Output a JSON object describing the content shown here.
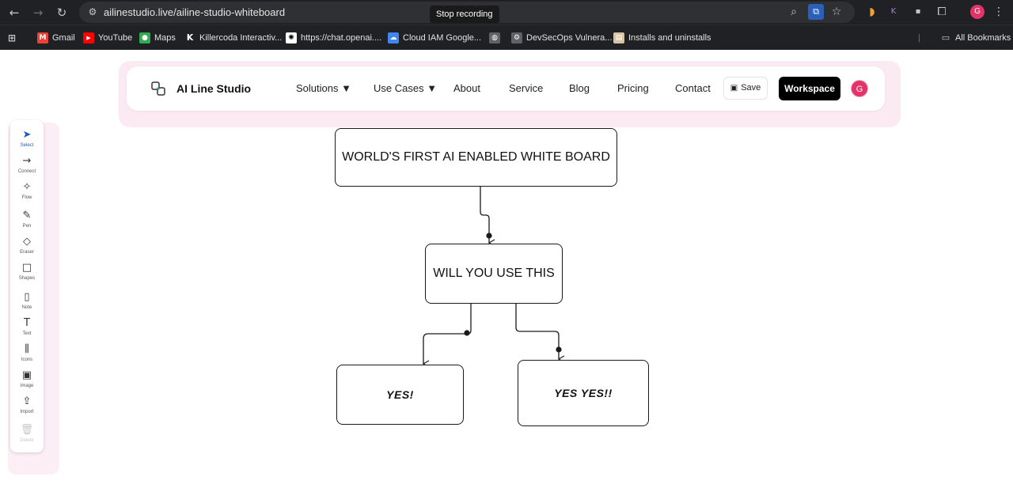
{
  "browser": {
    "url": "ailinestudio.live/ailine-studio-whiteboard",
    "recording_tip": "Stop recording",
    "profile_initial": "G",
    "bookmarks": [
      {
        "label": "Gmail",
        "icon": "gmail-icon"
      },
      {
        "label": "YouTube",
        "icon": "youtube-icon"
      },
      {
        "label": "Maps",
        "icon": "maps-icon"
      },
      {
        "label": "Killercoda Interactiv...",
        "icon": "killercoda-icon"
      },
      {
        "label": "https://chat.openai....",
        "icon": "openai-icon"
      },
      {
        "label": "Cloud IAM Google...",
        "icon": "google-cloud-icon"
      },
      {
        "label": "",
        "icon": "globe-icon"
      },
      {
        "label": "DevSecOps Vulnera...",
        "icon": "devsecops-icon"
      },
      {
        "label": "Installs and uninstalls",
        "icon": "installs-icon"
      }
    ],
    "all_bookmarks": "All Bookmarks"
  },
  "navbar": {
    "brand": "AI Line Studio",
    "menu": [
      "Solutions ▼",
      "Use Cases ▼",
      "About",
      "Service",
      "Blog",
      "Pricing",
      "Contact"
    ],
    "save_label": "Save",
    "workspace_label": "Workspace",
    "user_initial": "G"
  },
  "toolbar": {
    "tools": [
      {
        "label": "Select",
        "icon": "cursor-icon",
        "glyph": "➤"
      },
      {
        "label": "Connect",
        "icon": "arrow-right-icon",
        "glyph": "→"
      },
      {
        "label": "Flow",
        "icon": "sparkles-icon",
        "glyph": "✧"
      },
      {
        "label": "Pen",
        "icon": "pen-icon",
        "glyph": "✎"
      },
      {
        "label": "Eraser",
        "icon": "eraser-icon",
        "glyph": "◇"
      },
      {
        "label": "Shapes",
        "icon": "square-icon",
        "glyph": "□"
      },
      {
        "label": "Note",
        "icon": "note-icon",
        "glyph": "▯"
      },
      {
        "label": "Text",
        "icon": "text-icon",
        "glyph": "T"
      },
      {
        "label": "Icons",
        "icon": "library-icon",
        "glyph": "⫼"
      },
      {
        "label": "Image",
        "icon": "image-icon",
        "glyph": "▣"
      },
      {
        "label": "Import",
        "icon": "upload-icon",
        "glyph": "⇪"
      },
      {
        "label": "Delete",
        "icon": "trash-icon",
        "glyph": "🗑"
      }
    ]
  },
  "whiteboard": {
    "nodes": [
      {
        "id": "n1",
        "text": "WORLD'S FIRST AI ENABLED WHITE BOARD"
      },
      {
        "id": "n2",
        "text": "WILL YOU USE THIS"
      },
      {
        "id": "n3",
        "text": "YES!"
      },
      {
        "id": "n4",
        "text": "YES YES!!"
      }
    ]
  },
  "colors": {
    "chrome_bg": "#202124",
    "accent": "#1e5bbd",
    "avatar": "#e2346a",
    "workspace_btn": "#000000"
  }
}
